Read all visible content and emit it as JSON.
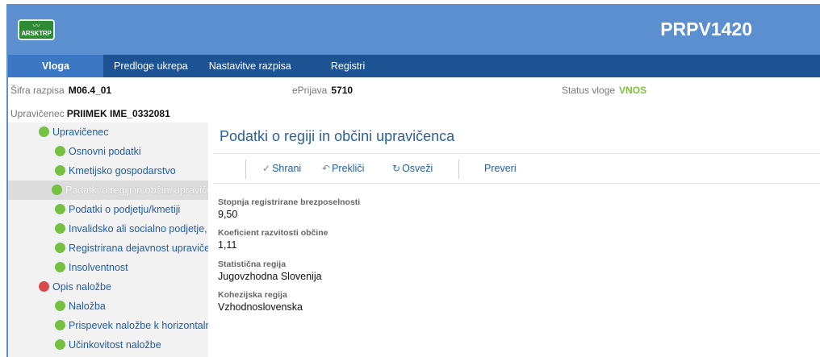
{
  "header": {
    "logo_text": "ARSKTRP",
    "app_code": "PRPV1420"
  },
  "nav": [
    "Vloga",
    "Predloge ukrepa",
    "Nastavitve razpisa",
    "Registri"
  ],
  "info": {
    "sifra_label": "Šifra razpisa",
    "sifra_value": "M06.4_01",
    "eprijava_label": "ePrijava",
    "eprijava_value": "5710",
    "status_label": "Status vloge",
    "status_value": "VNOS",
    "upravicenec_label": "Upravičenec",
    "upravicenec_value": "PRIIMEK IME_0332081"
  },
  "sidebar": [
    {
      "label": "Upravičenec",
      "status": "green",
      "level": 0,
      "selected": false
    },
    {
      "label": "Osnovni podatki",
      "status": "green",
      "level": 1,
      "selected": false
    },
    {
      "label": "Kmetijsko gospodarstvo",
      "status": "green",
      "level": 1,
      "selected": false
    },
    {
      "label": "Podatki o regiji in občini upraviče",
      "status": "green",
      "level": 1,
      "selected": true
    },
    {
      "label": "Podatki o podjetju/kmetiji",
      "status": "green",
      "level": 1,
      "selected": false
    },
    {
      "label": "Invalidsko ali socialno podjetje,",
      "status": "green",
      "level": 1,
      "selected": false
    },
    {
      "label": "Registrirana dejavnost upraviče",
      "status": "green",
      "level": 1,
      "selected": false
    },
    {
      "label": "Insolventnost",
      "status": "green",
      "level": 1,
      "selected": false
    },
    {
      "label": "Opis naložbe",
      "status": "red",
      "level": 0,
      "selected": false
    },
    {
      "label": "Naložba",
      "status": "green",
      "level": 1,
      "selected": false
    },
    {
      "label": "Prispevek naložbe k horizontaln",
      "status": "green",
      "level": 1,
      "selected": false
    },
    {
      "label": "Učinkovitost naložbe",
      "status": "green",
      "level": 1,
      "selected": false
    }
  ],
  "content": {
    "title": "Podatki o regiji in občini upravičenca",
    "toolbar": {
      "save": "Shrani",
      "save_icon": "check-icon",
      "cancel": "Prekliči",
      "cancel_icon": "undo-icon",
      "refresh": "Osveži",
      "refresh_icon": "refresh-icon",
      "check": "Preveri"
    },
    "fields": [
      {
        "label": "Stopnja registrirane brezposelnosti",
        "value": "9,50"
      },
      {
        "label": "Koeficient razvitosti občine",
        "value": "1,11"
      },
      {
        "label": "Statistična regija",
        "value": "Jugovzhodna Slovenija"
      },
      {
        "label": "Kohezijska regija",
        "value": "Vzhodnoslovenska"
      }
    ]
  },
  "colors": {
    "header": "#5b8fd0",
    "nav": "#1d5393",
    "nav_active": "#3c77c4",
    "status_green": "#7cc13a",
    "dot_red": "#d94b4b",
    "dot_green": "#76c043"
  }
}
